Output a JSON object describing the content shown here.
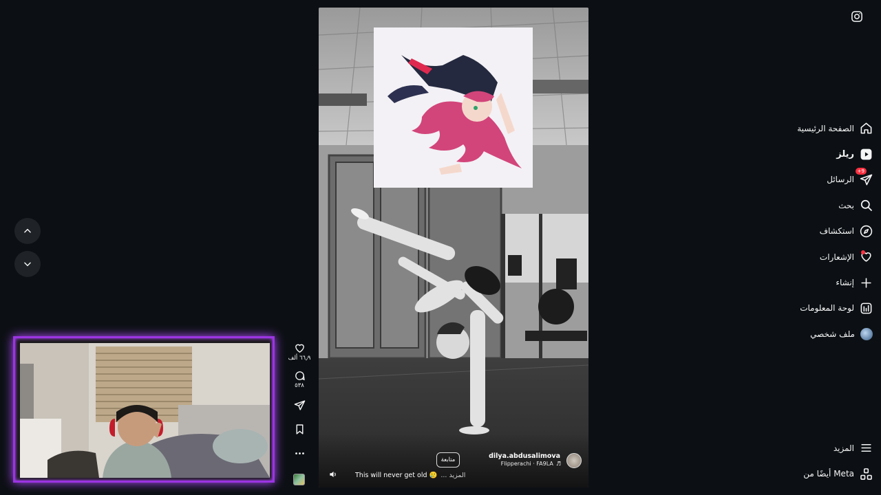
{
  "sidebar": {
    "items": [
      {
        "label": "الصفحة الرئيسية",
        "icon": "home-icon"
      },
      {
        "label": "ريلز",
        "icon": "reels-icon",
        "active": true
      },
      {
        "label": "الرسائل",
        "icon": "messages-icon",
        "badge": "+9"
      },
      {
        "label": "بحث",
        "icon": "search-icon"
      },
      {
        "label": "استكشاف",
        "icon": "explore-icon"
      },
      {
        "label": "الإشعارات",
        "icon": "heart-icon"
      },
      {
        "label": "إنشاء",
        "icon": "plus-icon"
      },
      {
        "label": "لوحة المعلومات",
        "icon": "dashboard-icon"
      },
      {
        "label": "ملف شخصي",
        "icon": "avatar"
      }
    ],
    "more_label": "المزيد",
    "meta_label": "أيضًا من Meta"
  },
  "reel": {
    "username": "dilya.abdusalimova",
    "audio": "Flipperachi · FA9LA",
    "follow_label": "متابعة",
    "caption": "This will never get old 🥲",
    "more_label": "... المزيد",
    "likes": "٦٦٫٩ ألف",
    "comments": "٥٣٨"
  },
  "colors": {
    "background": "#0c1014",
    "webcam_border": "#9c34e3",
    "badge": "#ff3040"
  }
}
